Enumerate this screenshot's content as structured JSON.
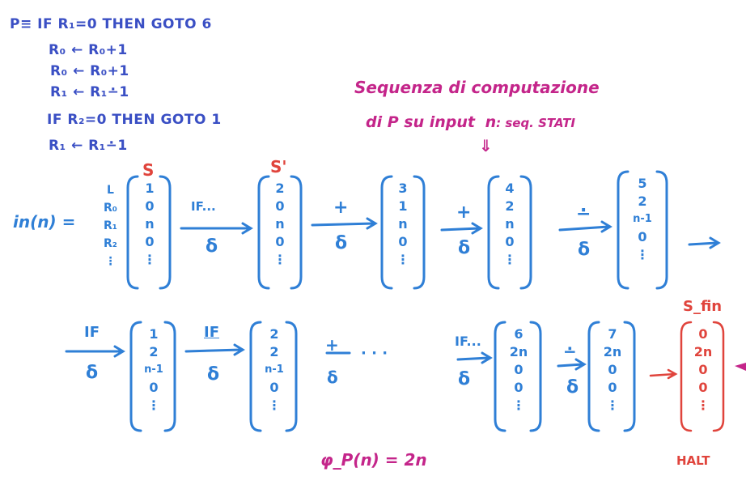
{
  "program": {
    "label": "P≡",
    "lines": [
      "IF R₁=0 THEN GOTO 6",
      "R₀ ← R₀+1",
      "R₀ ← R₀+1",
      "R₁ ← R₁∸1",
      "IF R₂=0 THEN GOTO 1",
      "R₁ ← R₁∸1"
    ]
  },
  "caption": {
    "line1": "Sequenza di computazione",
    "line2": "di P su input",
    "n": "n",
    "suffix": ": seq. STATI",
    "arrow": "⇓"
  },
  "row1": {
    "in_label": "in(n) =",
    "reg_labels": [
      "L",
      "R₀",
      "R₁",
      "R₂",
      "⋮"
    ],
    "states": [
      {
        "tag": "S",
        "values": [
          "1",
          "0",
          "n",
          "0",
          "⋮"
        ]
      },
      {
        "tag": "S'",
        "values": [
          "2",
          "0",
          "n",
          "0",
          "⋮"
        ]
      },
      {
        "tag": "",
        "values": [
          "3",
          "1",
          "n",
          "0",
          "⋮"
        ]
      },
      {
        "tag": "",
        "values": [
          "4",
          "2",
          "n",
          "0",
          "⋮"
        ]
      },
      {
        "tag": "",
        "values": [
          "5",
          "2",
          "n-1",
          "0",
          "⋮"
        ]
      }
    ],
    "transitions": [
      {
        "op": "IF...",
        "delta": "δ"
      },
      {
        "op": "+",
        "delta": "δ"
      },
      {
        "op": "+",
        "delta": "δ"
      },
      {
        "op": "∸",
        "delta": "δ"
      }
    ]
  },
  "row2": {
    "states": [
      {
        "values": [
          "1",
          "2",
          "n-1",
          "0",
          "⋮"
        ]
      },
      {
        "values": [
          "2",
          "2",
          "n-1",
          "0",
          "⋮"
        ]
      },
      {
        "values": [
          "6",
          "2n",
          "0",
          "0",
          "⋮"
        ]
      },
      {
        "values": [
          "7",
          "2n",
          "0",
          "0",
          "⋮"
        ]
      }
    ],
    "transitions": [
      {
        "op": "IF",
        "delta": "δ"
      },
      {
        "op": "IF",
        "delta": "δ"
      },
      {
        "op": "+",
        "delta": "δ"
      },
      {
        "op": "IF...",
        "delta": "δ"
      },
      {
        "op": "∸",
        "delta": "δ"
      }
    ],
    "ellipsis": "· · ·",
    "final": {
      "tag": "S_fin",
      "values": [
        "0",
        "2n",
        "0",
        "0",
        "⋮"
      ],
      "halt": "HALT"
    }
  },
  "result": "φ_P(n) = 2n",
  "colors": {
    "program": "#3a4fc4",
    "diagram": "#2f7fd6",
    "state_tag": "#e0443c",
    "caption": "#c4258a"
  }
}
